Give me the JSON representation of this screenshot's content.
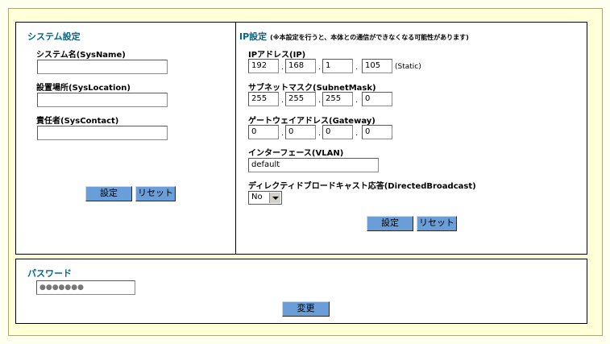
{
  "system": {
    "title": "システム設定",
    "sysname_label": "システム名(SysName)",
    "sysname_value": "",
    "location_label": "設置場所(SysLocation)",
    "location_value": "",
    "contact_label": "責任者(SysContact)",
    "contact_value": "",
    "set_label": "設定",
    "reset_label": "リセット"
  },
  "ip": {
    "title": "IP設定",
    "note": "(※本設定を行うと、本体との通信ができなくなる可能性があります)",
    "ip_label": "IPアドレス(IP)",
    "ip": [
      "192",
      "168",
      "1",
      "105"
    ],
    "ip_mode": "(Static)",
    "mask_label": "サブネットマスク(SubnetMask)",
    "mask": [
      "255",
      "255",
      "255",
      "0"
    ],
    "gateway_label": "ゲートウェイアドレス(Gateway)",
    "gateway": [
      "0",
      "0",
      "0",
      "0"
    ],
    "vlan_label": "インターフェース(VLAN)",
    "vlan_value": "default",
    "broadcast_label": "ディレクティドブロードキャスト応答(DirectedBroadcast)",
    "broadcast_value": "No",
    "set_label": "設定",
    "reset_label": "リセット"
  },
  "password": {
    "title": "パスワード",
    "value": "●●●●●●●",
    "change_label": "変更"
  },
  "dot": ".",
  "colors": {
    "title": "#00668c",
    "button": "#6a9ed8",
    "frame": "#ffffd8"
  }
}
